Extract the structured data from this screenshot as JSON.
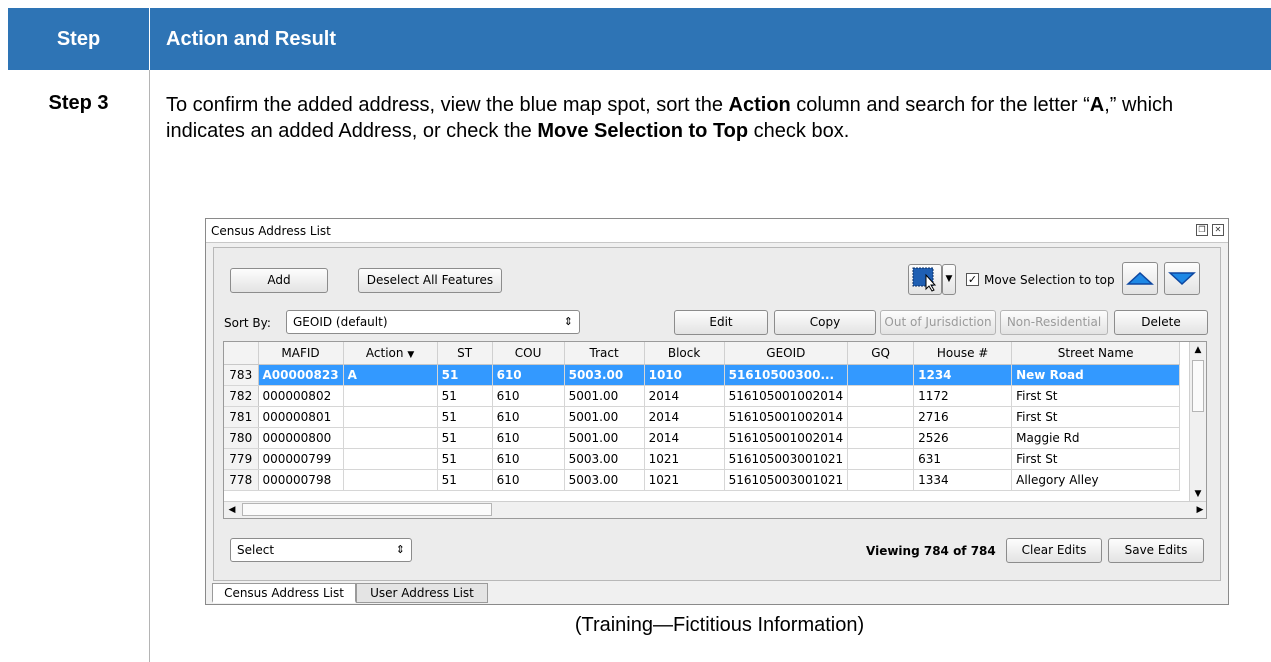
{
  "table_header": {
    "col1": "Step",
    "col2": "Action and Result"
  },
  "step": {
    "label": "Step 3",
    "text_1": "To confirm the added address, view the blue map spot, sort the ",
    "bold_1": "Action",
    "text_2": " column and search for the letter “",
    "bold_2": "A",
    "text_3": ",” which indicates an added Address, or check the ",
    "bold_3": "Move Selection to Top",
    "text_4": " check box."
  },
  "caption": "(Training—Fictitious Information)",
  "window": {
    "title": "Census Address List",
    "restore_icon": "restore-icon",
    "close_icon": "close-icon"
  },
  "toolbar": {
    "add_label": "Add",
    "deselect_label": "Deselect All Features",
    "move_selection_label": "Move Selection to top",
    "move_selection_checked": true,
    "sort_by_label": "Sort By:",
    "sort_by_value": "GEOID (default)",
    "edit_label": "Edit",
    "copy_label": "Copy",
    "out_of_jurisdiction_label": "Out of Jurisdiction",
    "non_residential_label": "Non-Residential",
    "delete_label": "Delete",
    "up_icon": "up-arrow-icon",
    "down_icon": "down-arrow-icon",
    "select_tool_icon": "selection-tool-icon"
  },
  "grid": {
    "columns": [
      "MAFID",
      "Action",
      "ST",
      "COU",
      "Tract",
      "Block",
      "GEOID",
      "GQ",
      "House #",
      "Street Name"
    ],
    "rows": [
      {
        "row_no": "783",
        "cells": [
          "A00000823",
          "A",
          "51",
          "610",
          "5003.00",
          "1010",
          "51610500300...",
          "",
          "1234",
          "New Road"
        ],
        "selected": true
      },
      {
        "row_no": "782",
        "cells": [
          "000000802",
          "",
          "51",
          "610",
          "5001.00",
          "2014",
          "516105001002014",
          "",
          "1172",
          "First St"
        ],
        "selected": false
      },
      {
        "row_no": "781",
        "cells": [
          "000000801",
          "",
          "51",
          "610",
          "5001.00",
          "2014",
          "516105001002014",
          "",
          "2716",
          "First St"
        ],
        "selected": false
      },
      {
        "row_no": "780",
        "cells": [
          "000000800",
          "",
          "51",
          "610",
          "5001.00",
          "2014",
          "516105001002014",
          "",
          "2526",
          "Maggie Rd"
        ],
        "selected": false
      },
      {
        "row_no": "779",
        "cells": [
          "000000799",
          "",
          "51",
          "610",
          "5003.00",
          "1021",
          "516105003001021",
          "",
          "631",
          "First St"
        ],
        "selected": false
      },
      {
        "row_no": "778",
        "cells": [
          "000000798",
          "",
          "51",
          "610",
          "5003.00",
          "1021",
          "516105003001021",
          "",
          "1334",
          "Allegory Alley"
        ],
        "selected": false
      }
    ]
  },
  "footer": {
    "select_value": "Select",
    "viewing": "Viewing 784 of 784",
    "clear_edits_label": "Clear Edits",
    "save_edits_label": "Save Edits"
  },
  "tabs": [
    {
      "label": "Census Address List",
      "active": true
    },
    {
      "label": "User Address List",
      "active": false
    }
  ],
  "colors": {
    "header_blue": "#2e74b5",
    "selection_blue": "#3399ff"
  }
}
